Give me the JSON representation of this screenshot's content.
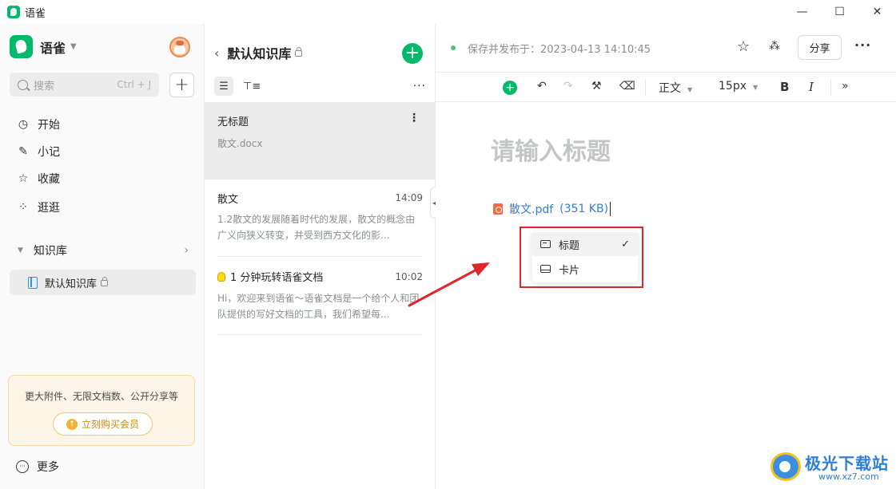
{
  "window": {
    "title": "语雀",
    "controls": [
      "—",
      "☐",
      "✕"
    ]
  },
  "sidebar": {
    "brand": "语雀",
    "search_placeholder": "搜索",
    "search_shortcut": "Ctrl + J",
    "add_label": "+",
    "nav": [
      {
        "label": "开始",
        "icon": "clock-icon"
      },
      {
        "label": "小记",
        "icon": "pen-icon"
      },
      {
        "label": "收藏",
        "icon": "star-icon"
      },
      {
        "label": "逛逛",
        "icon": "grid-icon"
      }
    ],
    "knowledge_header": "知识库",
    "knowledge_item": "默认知识库",
    "promo_text": "更大附件、无限文档数、公开分享等",
    "promo_button": "立刻购买会员",
    "more_label": "更多"
  },
  "list": {
    "header": "默认知识库",
    "docs": [
      {
        "title": "无标题",
        "desc": "散文.docx",
        "time": ""
      },
      {
        "title": "散文",
        "time": "14:09",
        "desc": "1.2散文的发展随着时代的发展，散文的概念由广义向狭义转变，并受到西方文化的影..."
      },
      {
        "title": "1 分钟玩转语雀文档",
        "time": "10:02",
        "desc": "Hi，欢迎来到语雀～语雀文档是一个给个人和团队提供的写好文档的工具，我们希望每..."
      }
    ]
  },
  "editor": {
    "saved_text": "保存并发布于：2023-04-13 14:10:45",
    "share_label": "分享",
    "style_select": "正文",
    "size_select": "15px",
    "bold_label": "B",
    "italic_label": "I",
    "title_placeholder": "请输入标题",
    "attachment_name": "散文.pdf",
    "attachment_size": "(351 KB)",
    "display_menu": [
      {
        "label": "标题",
        "selected": true
      },
      {
        "label": "卡片",
        "selected": false
      }
    ]
  },
  "watermark": {
    "name": "极光下载站",
    "url": "www.xz7.com"
  },
  "colors": {
    "brand_green": "#00b96b",
    "link_blue": "#2f7fd8",
    "highlight_red": "#e0262b"
  }
}
